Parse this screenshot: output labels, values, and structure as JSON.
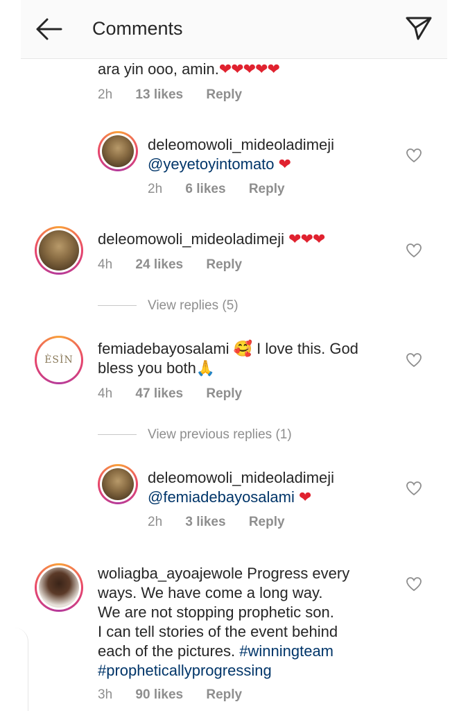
{
  "header": {
    "title": "Comments"
  },
  "partial_comment": {
    "text": "ara yin  ooo, amin.",
    "hearts": "❤❤❤❤❤",
    "time": "2h",
    "likes": "13 likes",
    "reply": "Reply"
  },
  "comments": [
    {
      "username": "deleomowoli_mideoladimeji",
      "mention": "@yeyetoyintomato",
      "hearts": "❤",
      "time": "2h",
      "likes": "6 likes",
      "reply": "Reply"
    },
    {
      "username": "deleomowoli_mideoladimeji",
      "hearts": "❤❤❤",
      "time": "4h",
      "likes": "24 likes",
      "reply": "Reply"
    },
    {
      "username": "femiadebayosalami",
      "avatar_text": "ÈSÌN",
      "text_line1": "🥰 I love this. God",
      "text_line2": "bless you both🙏",
      "time": "4h",
      "likes": "47 likes",
      "reply": "Reply"
    },
    {
      "username": "deleomowoli_mideoladimeji",
      "mention": "@femiadebayosalami",
      "hearts": "❤",
      "time": "2h",
      "likes": "3 likes",
      "reply": "Reply"
    },
    {
      "username": "woliagba_ayoajewole",
      "text_line1": "Progress every",
      "text_line2": "ways. We have come a long way.",
      "text_line3": "We are not stopping prophetic son.",
      "text_line4": "I can tell stories of the event behind",
      "text_line5": "each of the pictures.",
      "hashtag1": "#winningteam",
      "hashtag2": "#propheticallyprogressing",
      "time": "3h",
      "likes": "90 likes",
      "reply": "Reply"
    }
  ],
  "view_replies": "View replies (5)",
  "view_previous_replies": "View previous replies (1)",
  "colors": {
    "heart": "#e0222f",
    "link": "#003569",
    "meta": "#8e8e8e"
  },
  "icons": [
    "back-arrow-icon",
    "send-icon",
    "heart-outline-icon"
  ]
}
